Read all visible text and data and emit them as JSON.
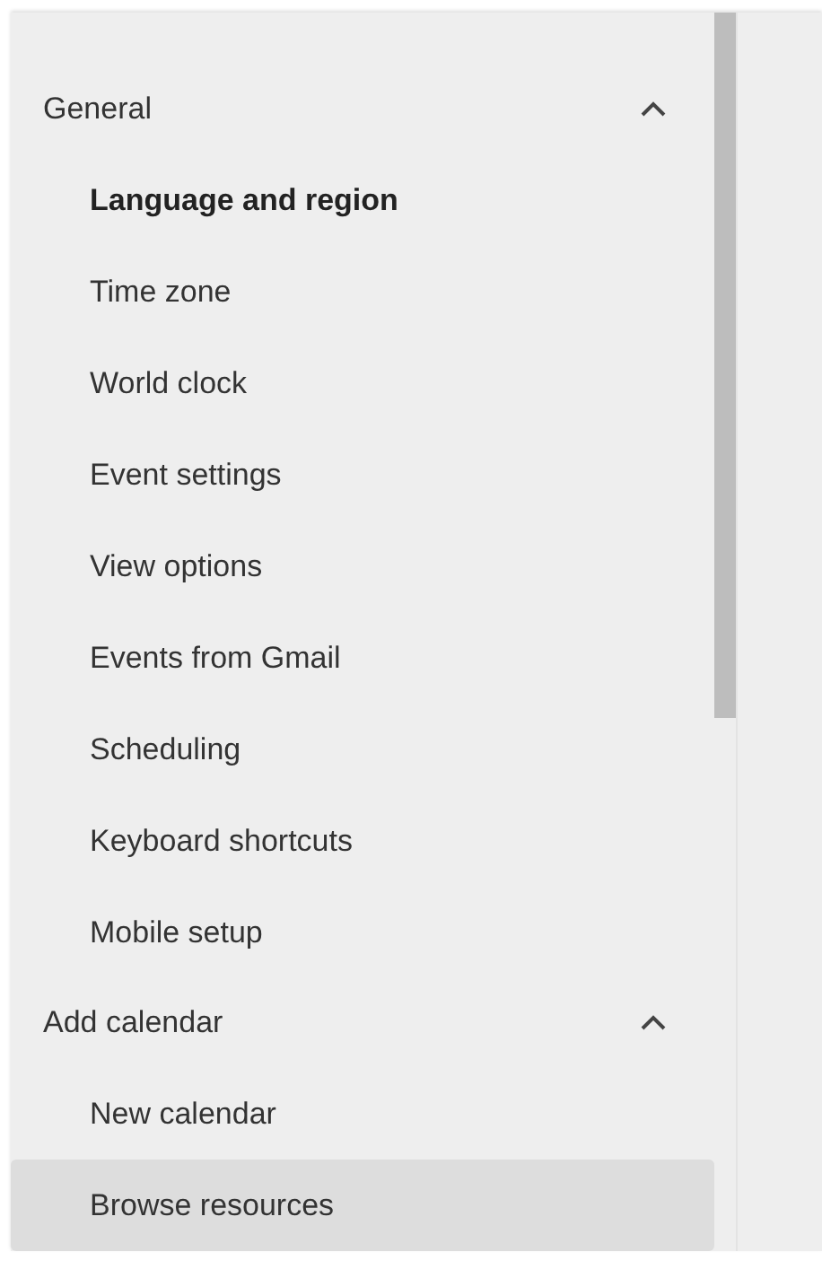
{
  "sections": [
    {
      "title": "General",
      "expanded": true,
      "items": [
        {
          "label": "Language and region",
          "active": true,
          "selected": false
        },
        {
          "label": "Time zone",
          "active": false,
          "selected": false
        },
        {
          "label": "World clock",
          "active": false,
          "selected": false
        },
        {
          "label": "Event settings",
          "active": false,
          "selected": false
        },
        {
          "label": "View options",
          "active": false,
          "selected": false
        },
        {
          "label": "Events from Gmail",
          "active": false,
          "selected": false
        },
        {
          "label": "Scheduling",
          "active": false,
          "selected": false
        },
        {
          "label": "Keyboard shortcuts",
          "active": false,
          "selected": false
        },
        {
          "label": "Mobile setup",
          "active": false,
          "selected": false
        }
      ]
    },
    {
      "title": "Add calendar",
      "expanded": true,
      "items": [
        {
          "label": "New calendar",
          "active": false,
          "selected": false
        },
        {
          "label": "Browse resources",
          "active": false,
          "selected": true
        }
      ]
    }
  ]
}
